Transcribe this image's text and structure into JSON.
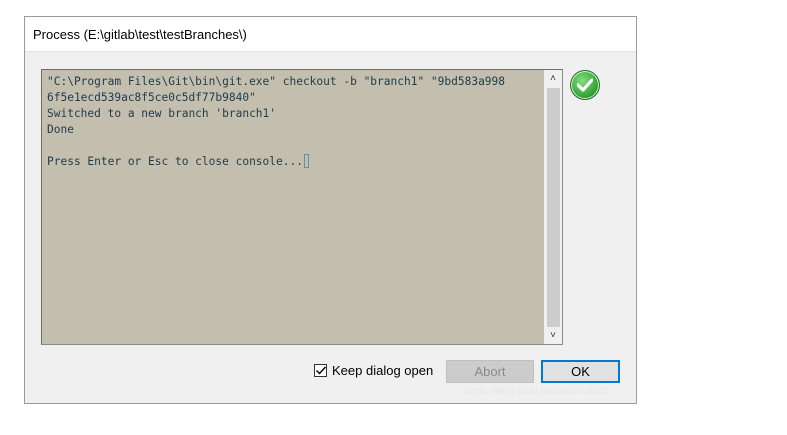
{
  "window": {
    "title": "Process (E:\\gitlab\\test\\testBranches\\)"
  },
  "console": {
    "lines": [
      "\"C:\\Program Files\\Git\\bin\\git.exe\" checkout -b \"branch1\" \"9bd583a998",
      "6f5e1ecd539ac8f5ce0c5df77b9840\"",
      "Switched to a new branch 'branch1'",
      "Done",
      "",
      "Press Enter or Esc to close console..."
    ]
  },
  "status_icon": "check-icon",
  "footer": {
    "keep_open_label": "Keep dialog open",
    "keep_open_checked": true,
    "abort_label": "Abort",
    "ok_label": "OK"
  },
  "watermark": "https://blog.csdn.net/lanbus2006",
  "colors": {
    "console_bg": "#c4beae",
    "console_text": "#1f3b4d",
    "ok_border": "#0078d7",
    "success": "#2e9b2f"
  }
}
